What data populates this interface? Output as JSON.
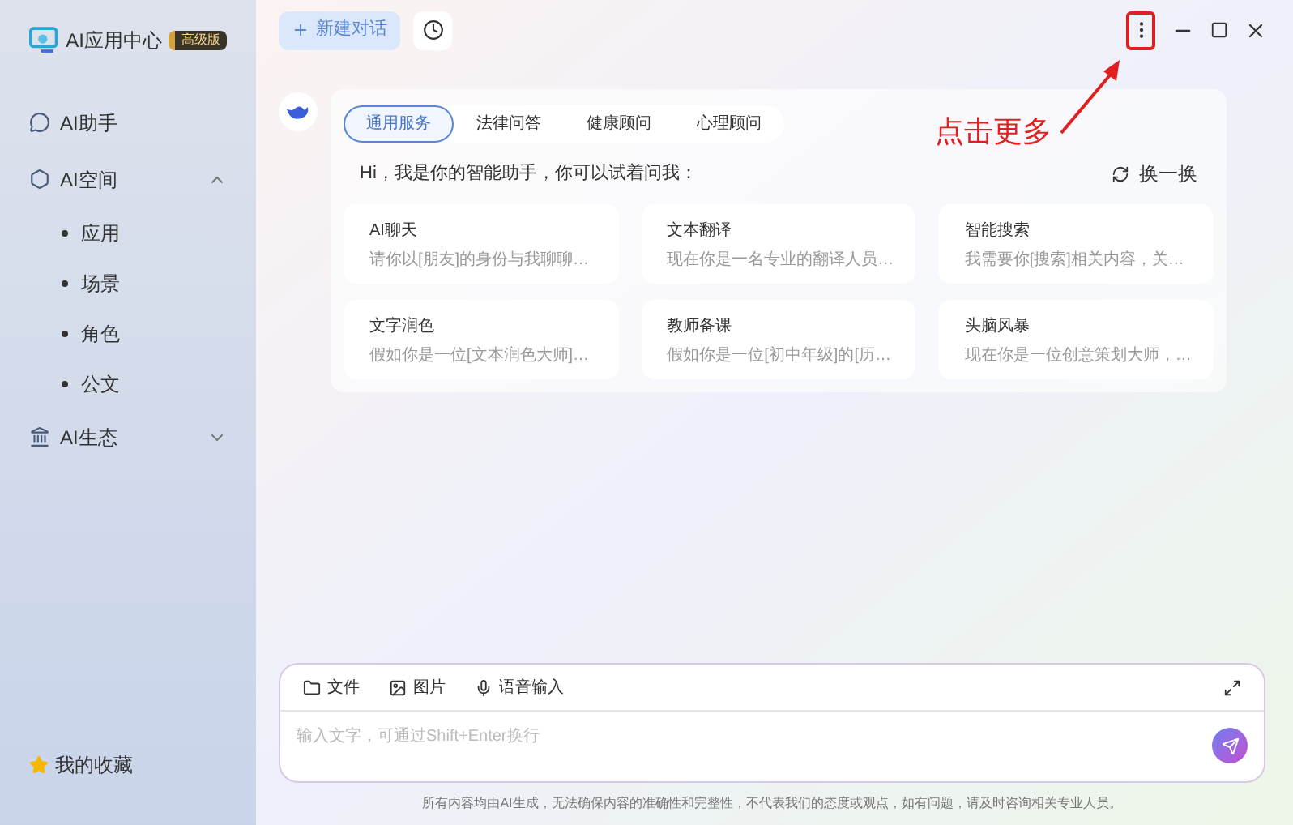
{
  "app": {
    "title": "AI应用中心",
    "badge": "高级版"
  },
  "sidebar": {
    "items": [
      {
        "kind": "chat",
        "label": "AI助手"
      },
      {
        "kind": "space",
        "label": "AI空间",
        "expanded": true,
        "children": [
          {
            "label": "应用"
          },
          {
            "label": "场景"
          },
          {
            "label": "角色"
          },
          {
            "label": "公文"
          }
        ]
      },
      {
        "kind": "eco",
        "label": "AI生态",
        "expanded": false
      }
    ],
    "favorites": "我的收藏"
  },
  "toolbar": {
    "new_chat": "新建对话"
  },
  "callout": {
    "text": "点击更多"
  },
  "assistant": {
    "tabs": [
      {
        "label": "通用服务",
        "selected": true
      },
      {
        "label": "法律问答",
        "selected": false
      },
      {
        "label": "健康顾问",
        "selected": false
      },
      {
        "label": "心理顾问",
        "selected": false
      }
    ],
    "greeting": "Hi，我是你的智能助手，你可以试着问我：",
    "refresh": "换一换",
    "cards": [
      {
        "title": "AI聊天",
        "desc": "请你以[朋友]的身份与我聊聊…"
      },
      {
        "title": "文本翻译",
        "desc": "现在你是一名专业的翻译人员…"
      },
      {
        "title": "智能搜索",
        "desc": "我需要你[搜索]相关内容，关…"
      },
      {
        "title": "文字润色",
        "desc": "假如你是一位[文本润色大师]…"
      },
      {
        "title": "教师备课",
        "desc": "假如你是一位[初中年级]的[历…"
      },
      {
        "title": "头脑风暴",
        "desc": "现在你是一位创意策划大师，…"
      }
    ]
  },
  "composer": {
    "tools": [
      {
        "kind": "file",
        "label": "文件"
      },
      {
        "kind": "image",
        "label": "图片"
      },
      {
        "kind": "voice",
        "label": "语音输入"
      }
    ],
    "placeholder": "输入文字，可通过Shift+Enter换行"
  },
  "disclaimer": "所有内容均由AI生成，无法确保内容的准确性和完整性，不代表我们的态度或观点，如有问题，请及时咨询相关专业人员。"
}
